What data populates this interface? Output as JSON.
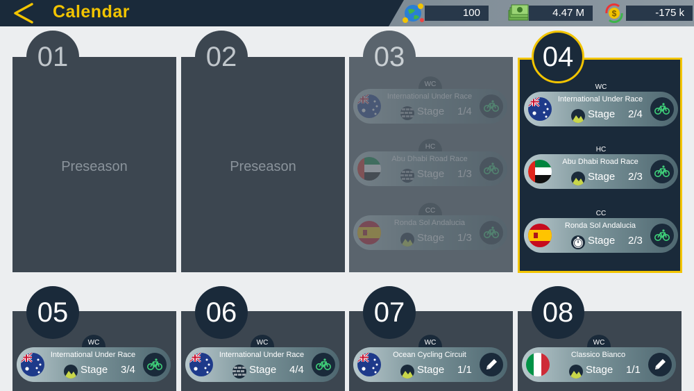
{
  "header": {
    "title": "Calendar",
    "resources": [
      {
        "name": "fans",
        "icon": "fans-globe-icon",
        "value": "100"
      },
      {
        "name": "money",
        "icon": "money-stack-icon",
        "value": "4.47 M"
      },
      {
        "name": "balance",
        "icon": "balance-coin-icon",
        "value": "-175 k"
      }
    ]
  },
  "weeks": [
    {
      "label": "01",
      "state": "preseason",
      "text": "Preseason"
    },
    {
      "label": "02",
      "state": "preseason",
      "text": "Preseason"
    },
    {
      "label": "03",
      "state": "past",
      "races": [
        {
          "category": "WC",
          "name": "International Under Race",
          "flag": "australia-flag-icon",
          "stage_icon": "cobbles-icon",
          "stage_label": "Stage",
          "stage": "1/4",
          "action": "bike-icon"
        },
        {
          "category": "HC",
          "name": "Abu Dhabi Road Race",
          "flag": "uae-flag-icon",
          "stage_icon": "cobbles-icon",
          "stage_label": "Stage",
          "stage": "1/3",
          "action": "bike-icon"
        },
        {
          "category": "CC",
          "name": "Ronda Sol Andalucia",
          "flag": "spain-flag-icon",
          "stage_icon": "mountain-icon",
          "stage_label": "Stage",
          "stage": "1/3",
          "action": "bike-icon"
        }
      ]
    },
    {
      "label": "04",
      "state": "current",
      "races": [
        {
          "category": "WC",
          "name": "International Under Race",
          "flag": "australia-flag-icon",
          "stage_icon": "mountain-icon",
          "stage_label": "Stage",
          "stage": "2/4",
          "action": "bike-icon"
        },
        {
          "category": "HC",
          "name": "Abu Dhabi Road Race",
          "flag": "uae-flag-icon",
          "stage_icon": "mountain-icon",
          "stage_label": "Stage",
          "stage": "2/3",
          "action": "bike-icon"
        },
        {
          "category": "CC",
          "name": "Ronda Sol Andalucia",
          "flag": "spain-flag-icon",
          "stage_icon": "stopwatch-icon",
          "stage_label": "Stage",
          "stage": "2/3",
          "action": "bike-icon"
        }
      ]
    },
    {
      "label": "05",
      "state": "future",
      "races": [
        {
          "category": "WC",
          "name": "International Under Race",
          "flag": "australia-flag-icon",
          "stage_icon": "mountain-icon",
          "stage_label": "Stage",
          "stage": "3/4",
          "action": "bike-icon"
        }
      ]
    },
    {
      "label": "06",
      "state": "future",
      "races": [
        {
          "category": "WC",
          "name": "International Under Race",
          "flag": "australia-flag-icon",
          "stage_icon": "cobbles-icon",
          "stage_label": "Stage",
          "stage": "4/4",
          "action": "bike-icon"
        }
      ]
    },
    {
      "label": "07",
      "state": "future",
      "races": [
        {
          "category": "WC",
          "name": "Ocean Cycling Circuit",
          "flag": "australia-flag-icon",
          "stage_icon": "mountain-icon",
          "stage_label": "Stage",
          "stage": "1/1",
          "action": "edit-icon"
        }
      ]
    },
    {
      "label": "08",
      "state": "future",
      "races": [
        {
          "category": "WC",
          "name": "Classico Bianco",
          "flag": "italy-flag-icon",
          "stage_icon": "mountain-icon",
          "stage_label": "Stage",
          "stage": "1/1",
          "action": "edit-icon"
        }
      ]
    }
  ],
  "colors": {
    "accent": "#f2c400",
    "navy": "#1a2a3a",
    "card": "#3c4650",
    "background": "#eceef0"
  }
}
